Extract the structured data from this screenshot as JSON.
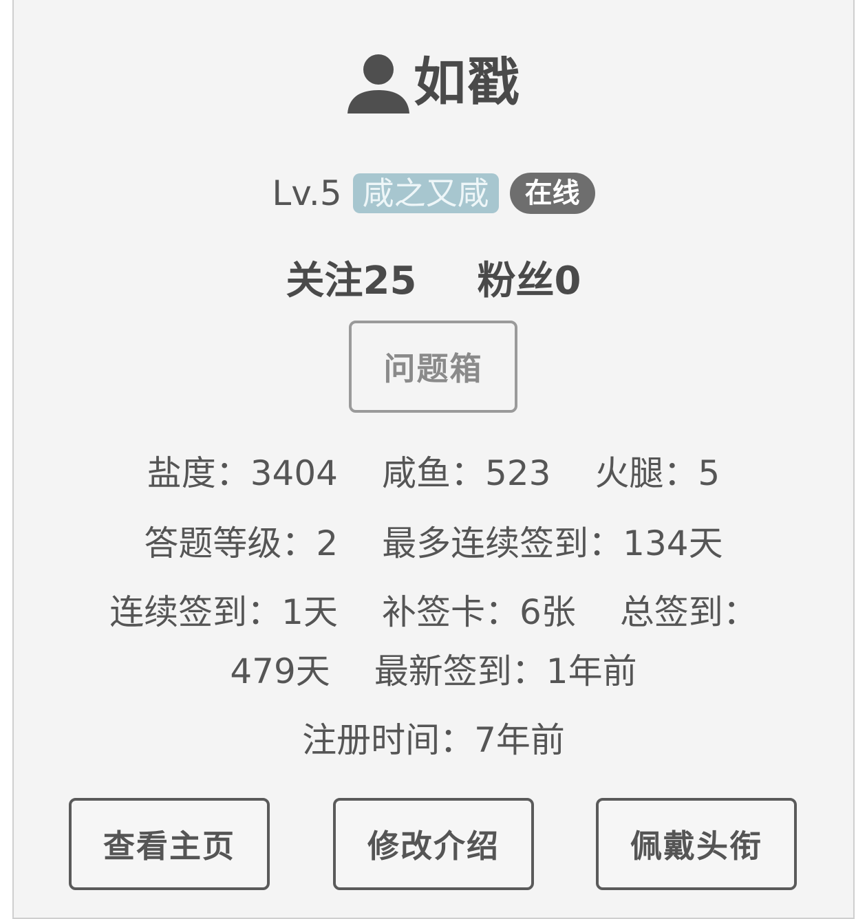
{
  "profile": {
    "username": "如戳",
    "user_icon": "user-silhouette-icon",
    "level": "Lv.5",
    "title_badge": "咸之又咸",
    "status_badge": "在线",
    "follow": "关注25",
    "fans": "粉丝0",
    "question_box": "问题箱"
  },
  "stats": {
    "salt": "盐度：3404",
    "salted_fish": "咸鱼：523",
    "ham": "火腿：5",
    "quiz_level": "答题等级：2",
    "max_streak": "最多连续签到：134天",
    "streak": "连续签到：1天",
    "makeup_cards": "补签卡：6张",
    "total_checkin_label": "总签到：",
    "total_checkin_value": "479天",
    "latest_checkin": "最新签到：1年前",
    "registered": "注册时间：7年前"
  },
  "actions": {
    "view_home": "查看主页",
    "edit_intro": "修改介绍",
    "wear_title": "佩戴头衔"
  },
  "colors": {
    "card_bg": "#f4f4f4",
    "title_badge_bg": "#a7c6cf",
    "status_badge_bg": "#6e6e6e"
  }
}
